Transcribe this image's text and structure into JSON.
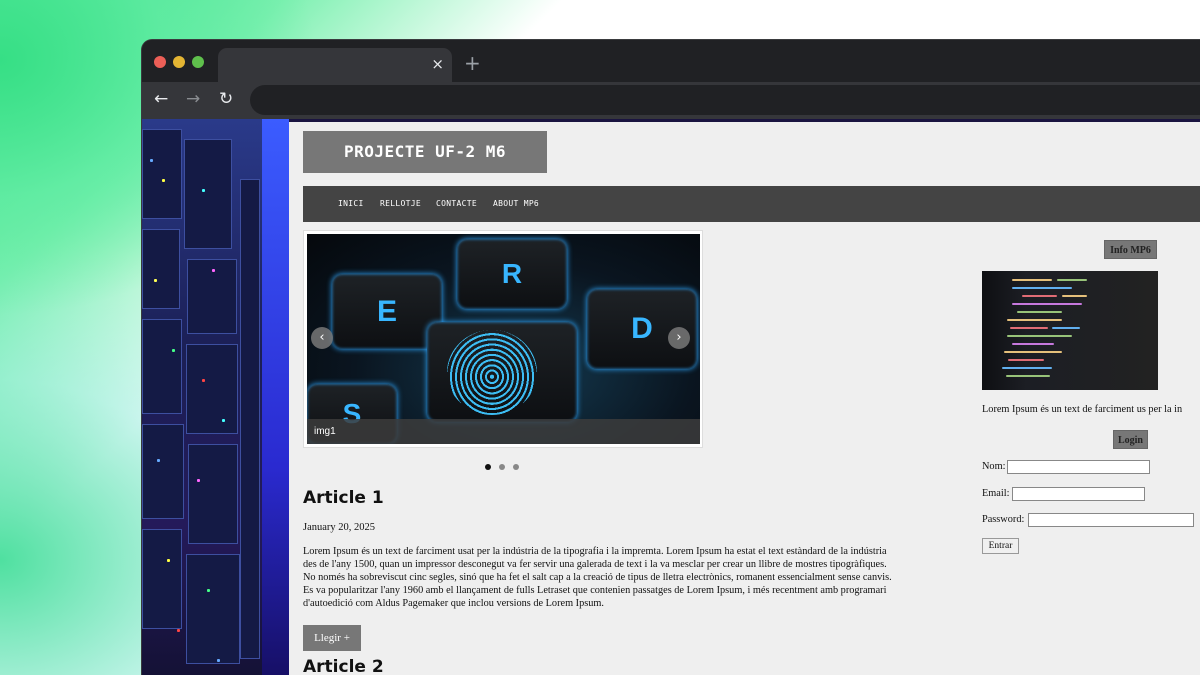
{
  "browser": {
    "tab_close": "×",
    "new_tab": "+",
    "back": "←",
    "forward": "→",
    "reload": "↻"
  },
  "site": {
    "title": "PROJECTE UF-2 M6",
    "nav": [
      "INICI",
      "RELLOTJE",
      "CONTACTE",
      "ABOUT MP6"
    ]
  },
  "carousel": {
    "caption": "img1",
    "prev": "‹",
    "next": "›",
    "slide_count": 3,
    "active_index": 0,
    "keys": [
      "E",
      "R",
      "D",
      "S"
    ]
  },
  "articles": [
    {
      "title": "Article 1",
      "date": "January 20, 2025",
      "body": "Lorem Ipsum és un text de farciment usat per la indústria de la tipografia i la impremta. Lorem Ipsum ha estat el text estàndard de la indústria des de l'any 1500, quan un impressor desconegut va fer servir una galerada de text i la va mesclar per crear un llibre de mostres tipogràfiques. No només ha sobreviscut cinc segles, sinó que ha fet el salt cap a la creació de tipus de lletra electrònics, romanent essencialment sense canvis. Es va popularitzar l'any 1960 amb el llançament de fulls Letraset que contenien passatges de Lorem Ipsum, i més recentment amb programari d'autoedició com Aldus Pagemaker que inclou versions de Lorem Ipsum.",
      "read_more": "Llegir +"
    },
    {
      "title": "Article 2"
    }
  ],
  "sidebar": {
    "info_title": "Info MP6",
    "info_text": "Lorem Ipsum és un text de farciment us per la in",
    "login_title": "Login",
    "fields": [
      {
        "label": "Nom:",
        "value": ""
      },
      {
        "label": "Email:",
        "value": ""
      },
      {
        "label": "Password:",
        "value": ""
      }
    ],
    "submit": "Entrar"
  },
  "colors": {
    "title_bg": "#777777",
    "nav_bg": "#444444",
    "page_bg": "#efefef",
    "key_glow": "#38b6ff"
  }
}
